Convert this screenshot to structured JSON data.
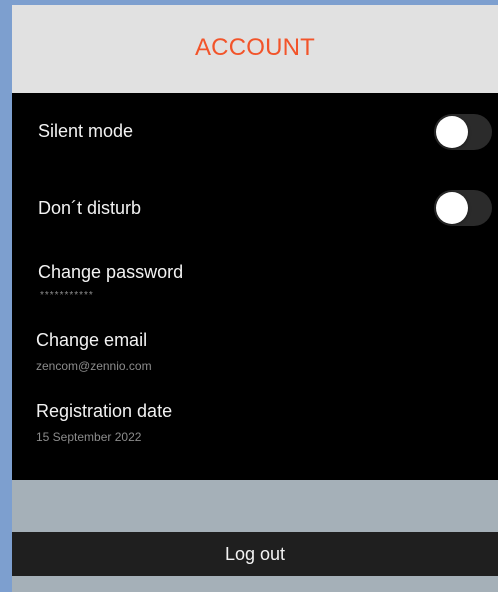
{
  "header": {
    "title": "ACCOUNT"
  },
  "colors": {
    "accent": "#f2542a",
    "header_bg": "#e1e1e1",
    "panel_bg": "#000000",
    "footer_bg": "#a5b0b8",
    "logout_bg": "#1f1f1f"
  },
  "settings": {
    "silent_mode": {
      "label": "Silent mode",
      "enabled": false
    },
    "dont_disturb": {
      "label": "Don´t disturb",
      "enabled": false
    },
    "change_password": {
      "label": "Change password",
      "value": "***********"
    },
    "change_email": {
      "label": "Change email",
      "value": "zencom@zennio.com"
    },
    "registration_date": {
      "label": "Registration date",
      "value": "15 September 2022"
    }
  },
  "footer": {
    "logout_label": "Log out"
  }
}
